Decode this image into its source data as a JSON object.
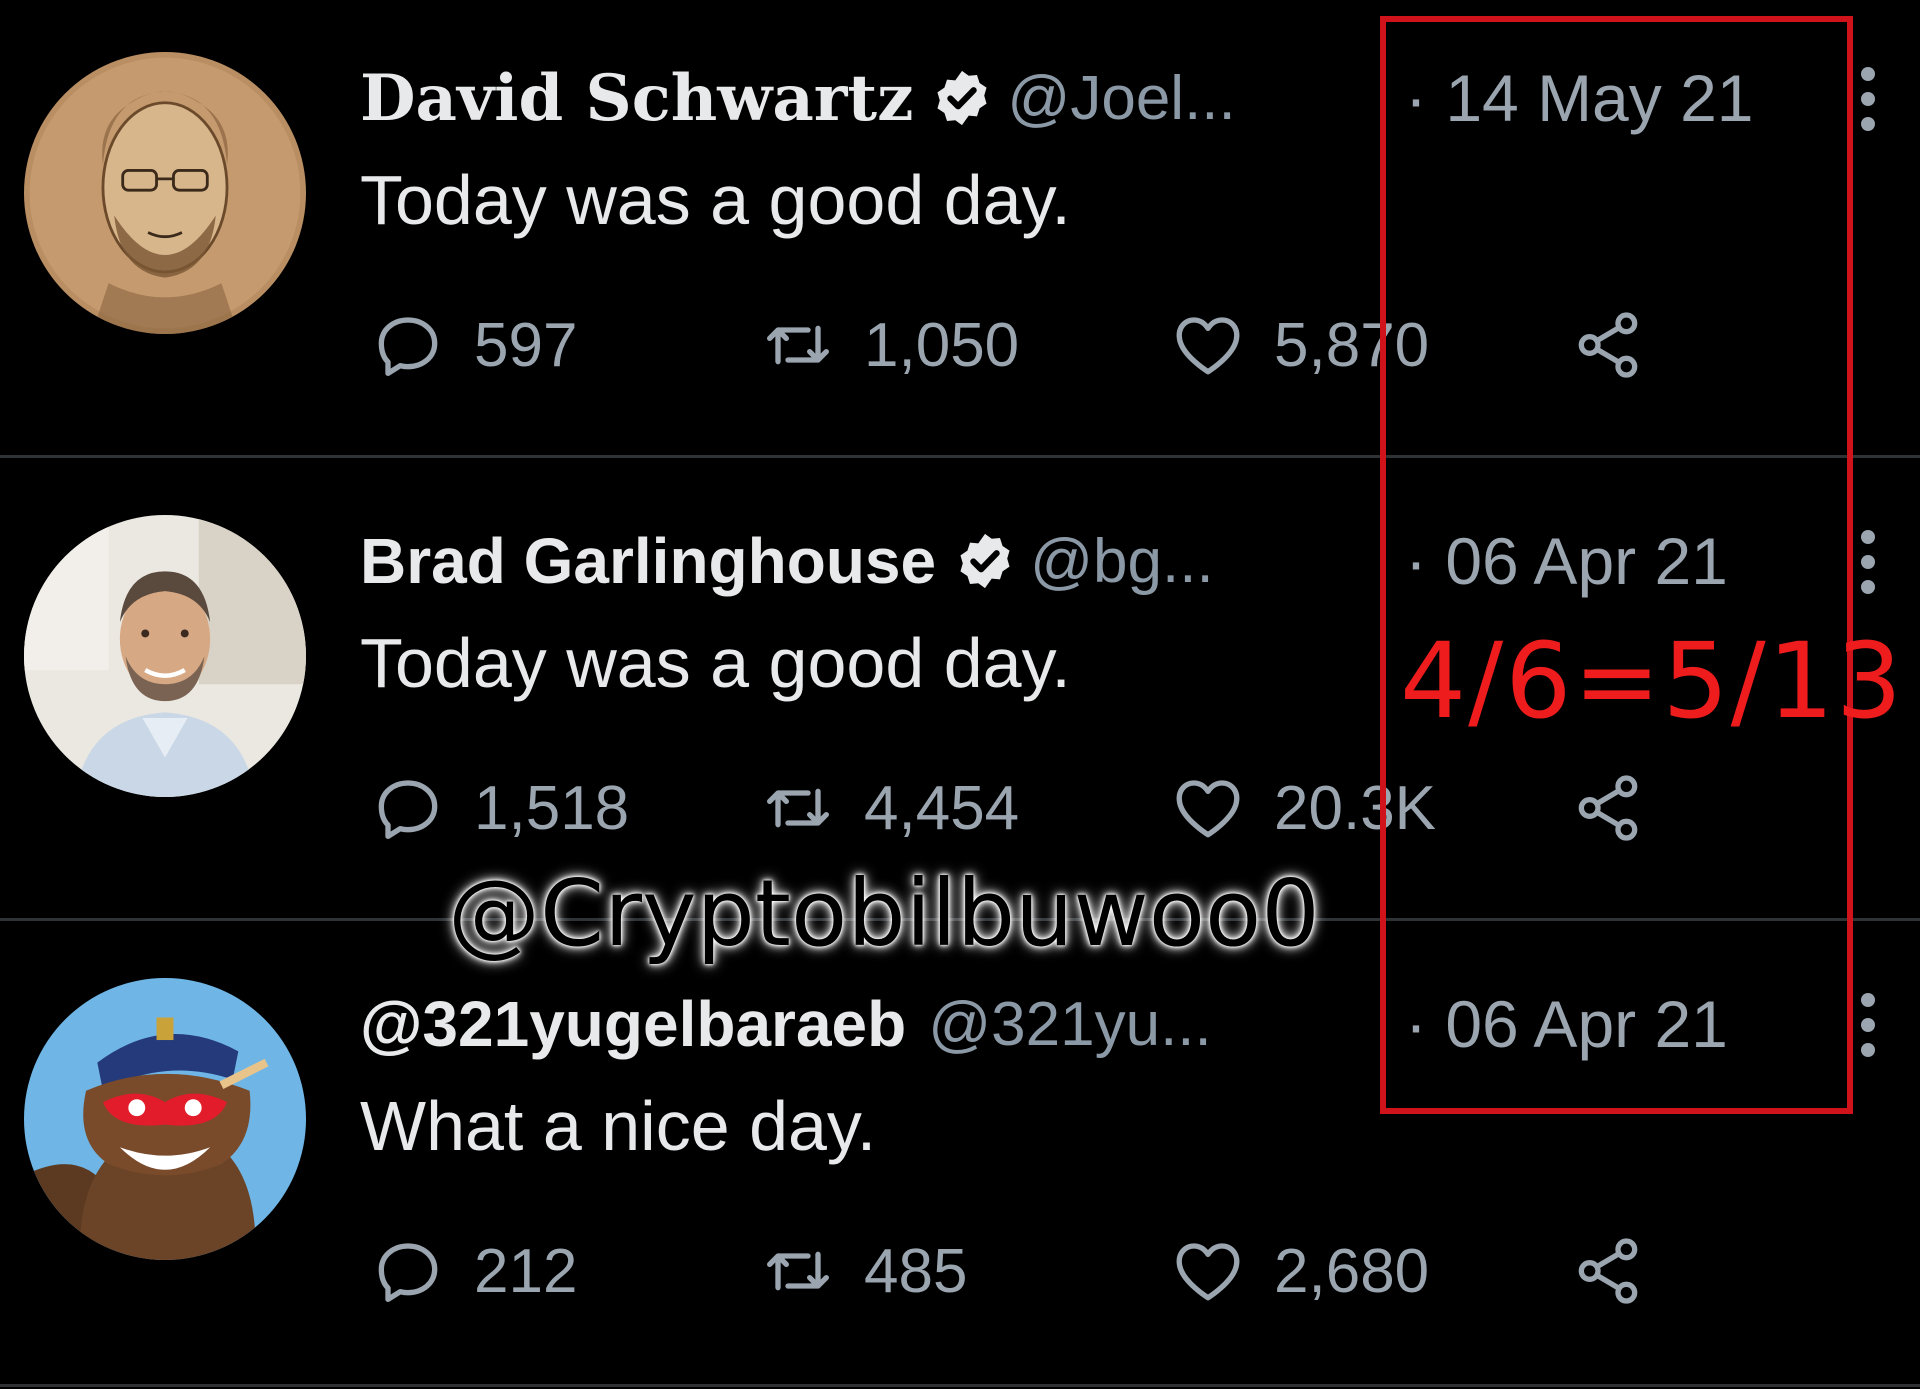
{
  "tweets": [
    {
      "display_name": "David Schwartz",
      "verified": true,
      "handle": "@Joel...",
      "date": "· 14 May 21",
      "text": "Today was a good day.",
      "replies": "597",
      "retweets": "1,050",
      "likes": "5,870",
      "avatar": "sketch-portrait"
    },
    {
      "display_name": "Brad Garlinghouse",
      "verified": true,
      "handle": "@bg...",
      "date": "· 06 Apr 21",
      "text": "Today was a good day.",
      "replies": "1,518",
      "retweets": "4,454",
      "likes": "20.3K",
      "avatar": "photo-portrait"
    },
    {
      "display_name": "@321yugelbaraeb",
      "verified": false,
      "handle": "@321yu...",
      "date": "· 06 Apr 21",
      "text": "What a nice day.",
      "replies": "212",
      "retweets": "485",
      "likes": "2,680",
      "avatar": "cartoon-bear"
    }
  ],
  "annotation": "4/6=5/13",
  "watermark": "@Cryptobilbuwoo0",
  "colors": {
    "background": "#000000",
    "text": "#e7e9ea",
    "muted": "#9aa5b0",
    "highlight": "#d0121b",
    "annotation": "#ee1c1c"
  }
}
